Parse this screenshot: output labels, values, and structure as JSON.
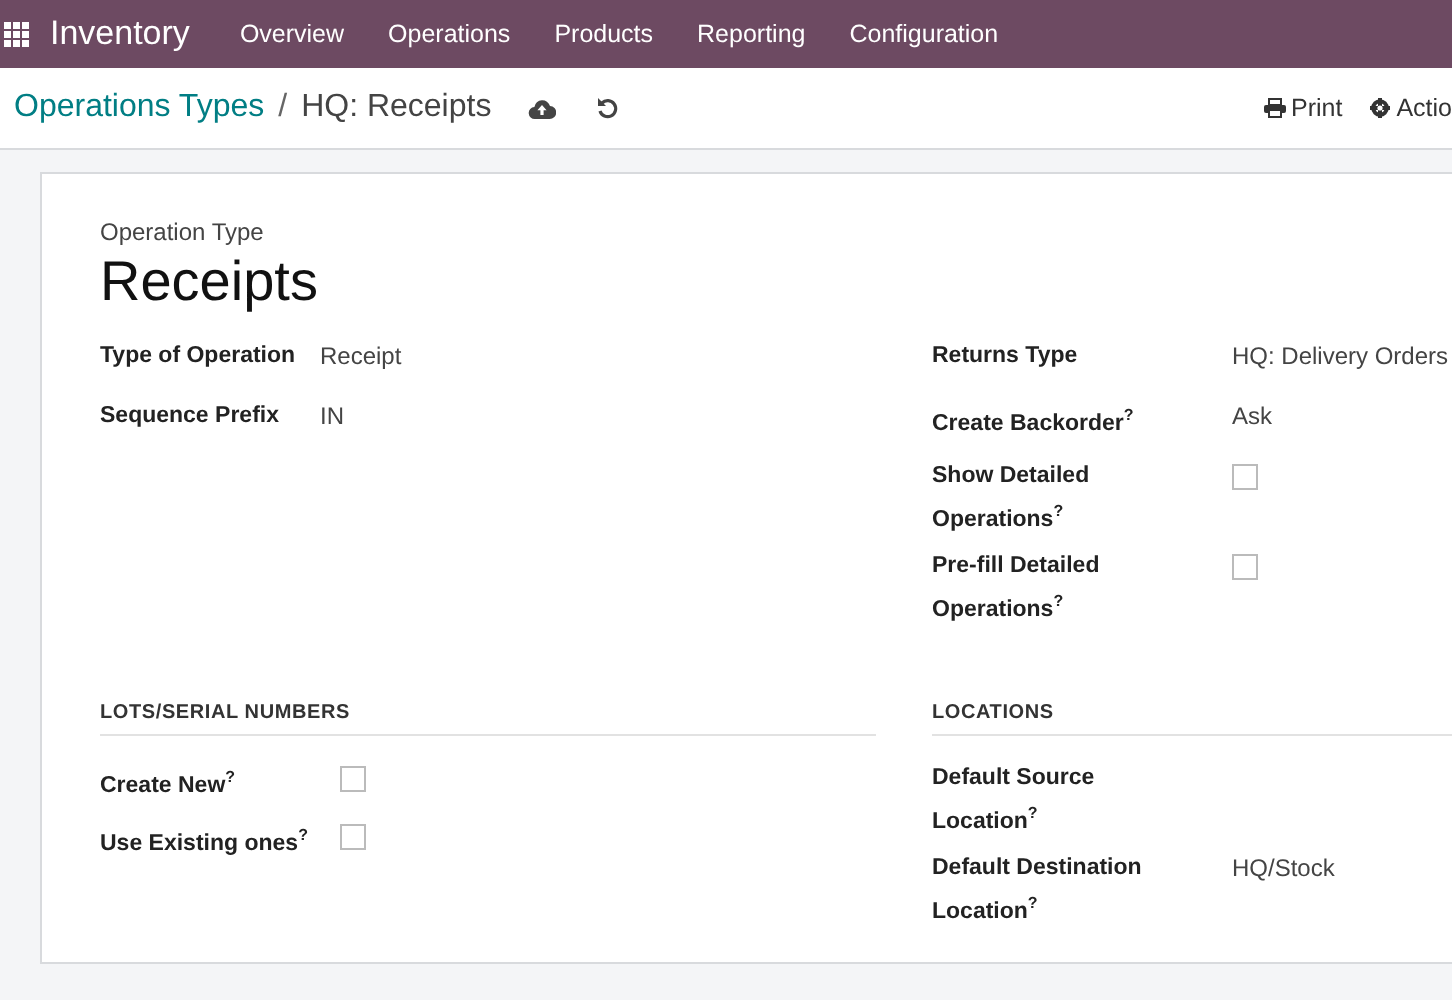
{
  "navbar": {
    "app_name": "Inventory",
    "menu": [
      "Overview",
      "Operations",
      "Products",
      "Reporting",
      "Configuration"
    ]
  },
  "breadcrumb": {
    "parent": "Operations Types",
    "separator": "/",
    "current": "HQ: Receipts"
  },
  "actions": [
    "Print",
    "Actio"
  ],
  "form": {
    "caption": "Operation Type",
    "title": "Receipts",
    "left_fields": [
      {
        "label": "Type of Operation",
        "value": "Receipt"
      },
      {
        "label": "Sequence Prefix",
        "value": "IN"
      }
    ],
    "right_fields": [
      {
        "kind": "text",
        "label": "Returns Type",
        "value": "HQ: Delivery Orders"
      },
      {
        "kind": "text",
        "label": "Create Backorder$^{?}$",
        "value": "Ask"
      },
      {
        "kind": "checkbox",
        "label": "Show Detailed Operations$^{?}$",
        "checked": false
      },
      {
        "kind": "checkbox",
        "label": "Pre-fill Detailed Operations$^{?}$",
        "checked": false
      }
    ],
    "sections": [
      {
        "title": "LOTS/SERIAL NUMBERS",
        "fields": [
          {
            "kind": "checkbox",
            "label": "Create New$^{?}$",
            "checked": false
          },
          {
            "kind": "checkbox",
            "label": "Use Existing ones$^{?}$",
            "checked": false
          }
        ]
      },
      {
        "title": "LOCATIONS",
        "fields": [
          {
            "kind": "text",
            "label": "Default Source Location$^{?}$"
          },
          {
            "kind": "text",
            "label": "Default Destination Location$^{?}$",
            "value": "HQ/Stock"
          }
        ]
      }
    ]
  }
}
